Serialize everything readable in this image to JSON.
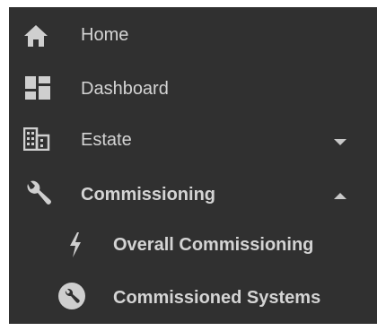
{
  "colors": {
    "background": "#303030",
    "text": "#d4d4d4",
    "icon": "#cfcfcf"
  },
  "nav": {
    "items": [
      {
        "label": "Home",
        "icon": "home-icon"
      },
      {
        "label": "Dashboard",
        "icon": "dashboard-icon"
      },
      {
        "label": "Estate",
        "icon": "building-icon",
        "expanded": false
      },
      {
        "label": "Commissioning",
        "icon": "wrench-icon",
        "expanded": true
      }
    ],
    "subitems": [
      {
        "label": "Overall Commissioning",
        "icon": "lightning-icon"
      },
      {
        "label": "Commissioned Systems",
        "icon": "wrench-circle-icon"
      }
    ]
  }
}
